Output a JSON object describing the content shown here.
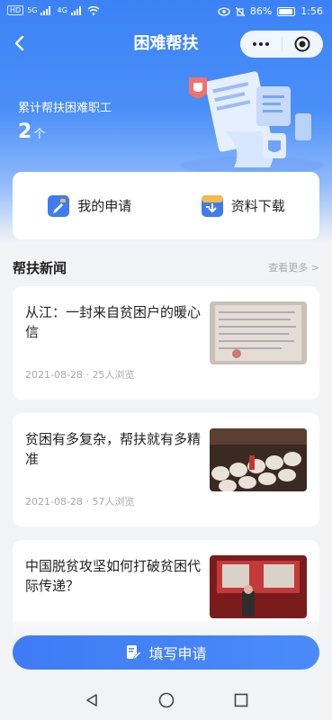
{
  "status_bar": {
    "left_chips": [
      "HD",
      "HD"
    ],
    "network_1": "5G",
    "network_2": "4G",
    "battery_percent": "86%",
    "time": "1:56"
  },
  "navbar": {
    "title": "困难帮扶",
    "back_icon": "back-chevron-icon",
    "more_icon": "more-dots-icon",
    "close_icon": "target-circle-icon"
  },
  "stats": {
    "label": "累计帮扶困难职工",
    "value": "2",
    "unit": "个"
  },
  "actions": [
    {
      "label": "我的申请",
      "icon": "pencil-doc-icon"
    },
    {
      "label": "资料下载",
      "icon": "download-doc-icon"
    }
  ],
  "news_section": {
    "title": "帮扶新闻",
    "more_label": "查看更多 >"
  },
  "news": [
    {
      "title": "从江：一封来自贫困户的暖心信",
      "date": "2021-08-28",
      "views": "25人浏览"
    },
    {
      "title": "贫困有多复杂，帮扶就有多精准",
      "date": "2021-08-28",
      "views": "57人浏览"
    },
    {
      "title": "中国脱贫攻坚如何打破贫困代际传递？",
      "date": "",
      "views": ""
    }
  ],
  "submit_button": {
    "label": "填写申请",
    "icon": "edit-form-icon"
  },
  "colors": {
    "primary": "#3b82f6",
    "card": "#ffffff",
    "background": "#f2f3f5"
  }
}
